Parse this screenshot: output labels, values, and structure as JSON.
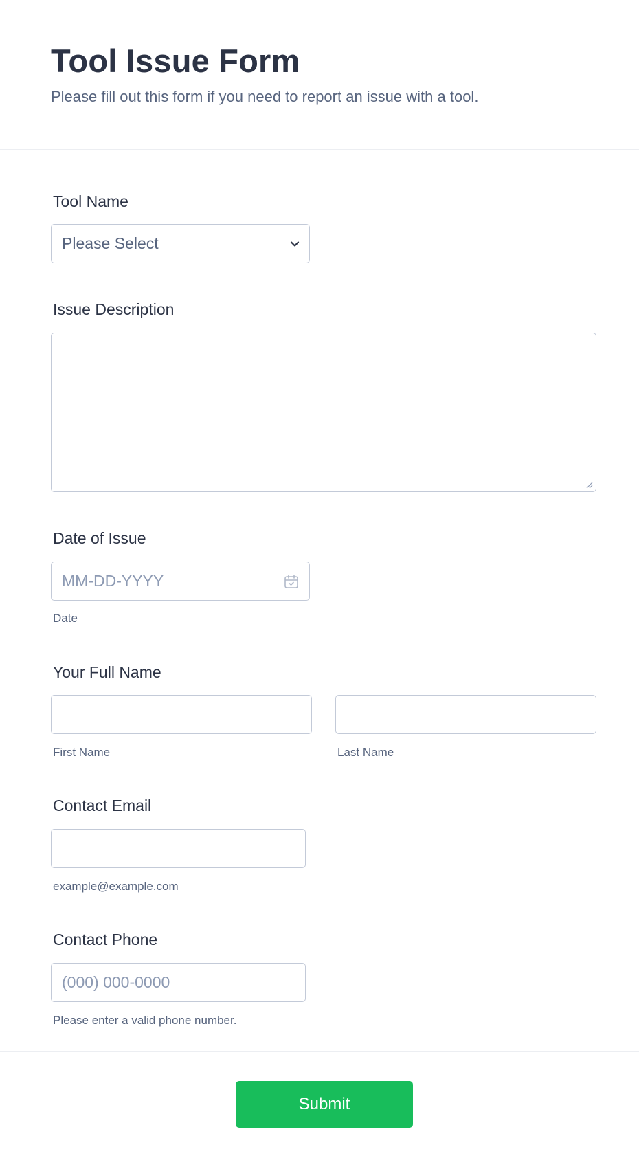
{
  "header": {
    "title": "Tool Issue Form",
    "subtitle": "Please fill out this form if you need to report an issue with a tool."
  },
  "fields": {
    "tool_name": {
      "label": "Tool Name",
      "selected": "Please Select",
      "icon": "chevron-down-icon"
    },
    "issue_description": {
      "label": "Issue Description",
      "value": ""
    },
    "date_of_issue": {
      "label": "Date of Issue",
      "placeholder": "MM-DD-YYYY",
      "sublabel": "Date",
      "icon": "calendar-icon"
    },
    "full_name": {
      "label": "Your Full Name",
      "first_sublabel": "First Name",
      "last_sublabel": "Last Name",
      "first_value": "",
      "last_value": ""
    },
    "contact_email": {
      "label": "Contact Email",
      "value": "",
      "sublabel": "example@example.com"
    },
    "contact_phone": {
      "label": "Contact Phone",
      "placeholder": "(000) 000-0000",
      "sublabel": "Please enter a valid phone number."
    }
  },
  "submit": {
    "label": "Submit"
  },
  "colors": {
    "title": "#2c3345",
    "muted": "#57647e",
    "border": "#c3cad8",
    "submit_bg": "#18bd5b"
  }
}
